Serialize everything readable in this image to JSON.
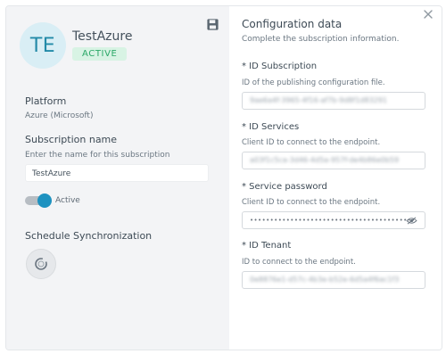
{
  "profile": {
    "initials": "TE",
    "name": "TestAzure",
    "status": "ACTIVE"
  },
  "left": {
    "platform_label": "Platform",
    "platform_value": "Azure (Microsoft)",
    "subscription_label": "Subscription name",
    "subscription_help": "Enter the name for this subscription",
    "subscription_value": "TestAzure",
    "active_toggle_label": "Active",
    "active_toggle_on": true,
    "schedule_label": "Schedule Synchronization"
  },
  "right": {
    "title": "Configuration data",
    "subtitle": "Complete the subscription information.",
    "fields": [
      {
        "label": "* ID Subscription",
        "help": "ID of the publishing configuration file.",
        "value": "9ae6a4f-3965-4f16-af7b-9d8f1d83291"
      },
      {
        "label": "* ID Services",
        "help": "Client ID to connect to the endpoint.",
        "value": "a03f1c5ca-3d46-4d5a-957f-de4b86e0b59"
      },
      {
        "label": "* Service password",
        "help": "Client ID to connect to the endpoint.",
        "value": "•••••••••••••••••••••••••••••••••••••••••"
      },
      {
        "label": "* ID Tenant",
        "help": "ID to connect to the endpoint.",
        "value": "0e8876e1-d57c-4b3e-b52e-6d5a4f6ac1f3"
      }
    ]
  },
  "colors": {
    "accent": "#1e92c0",
    "badge_bg": "#d8f3e4",
    "badge_text": "#2aa767",
    "avatar_bg": "#d9eef5"
  },
  "icons": [
    "save-icon",
    "close-icon",
    "eye-icon",
    "sync-icon"
  ]
}
